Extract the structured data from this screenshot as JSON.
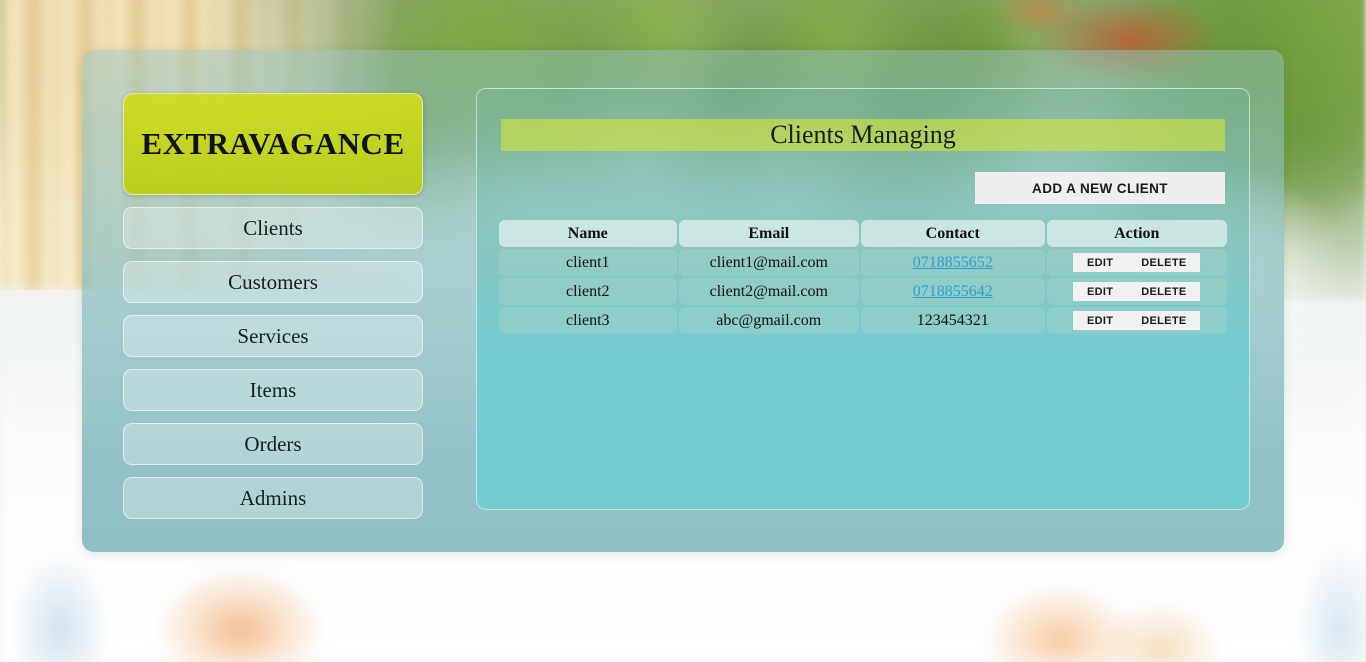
{
  "brand": {
    "name": "EXTRAVAGANCE"
  },
  "sidebar": {
    "items": [
      {
        "label": "Clients"
      },
      {
        "label": "Customers"
      },
      {
        "label": "Services"
      },
      {
        "label": "Items"
      },
      {
        "label": "Orders"
      },
      {
        "label": "Admins"
      }
    ]
  },
  "main": {
    "title": "Clients Managing",
    "add_button": "ADD A NEW CLIENT",
    "table": {
      "columns": [
        "Name",
        "Email",
        "Contact",
        "Action"
      ],
      "rows": [
        {
          "name": "client1",
          "email": "client1@mail.com",
          "contact": "0718855652",
          "contact_is_link": true,
          "edit": "EDIT",
          "delete": "DELETE"
        },
        {
          "name": "client2",
          "email": "client2@mail.com",
          "contact": "0718855642",
          "contact_is_link": true,
          "edit": "EDIT",
          "delete": "DELETE"
        },
        {
          "name": "client3",
          "email": "abc@gmail.com",
          "contact": "123454321",
          "contact_is_link": false,
          "edit": "EDIT",
          "delete": "DELETE"
        }
      ]
    }
  },
  "colors": {
    "brand_yellow": "#d0dc1a",
    "panel_teal": "#8fc0c4",
    "content_cyan": "#72cbd0",
    "link_blue": "#2e9fd4",
    "button_grey": "#efefef"
  }
}
